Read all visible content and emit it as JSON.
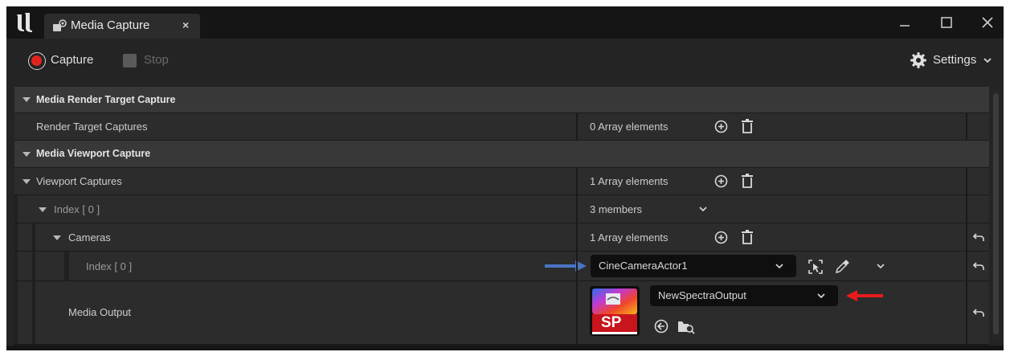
{
  "window": {
    "tab_title": "Media Capture",
    "tab_close": "×",
    "controls": [
      "minimize-icon",
      "maximize-icon",
      "close-icon"
    ]
  },
  "toolbar": {
    "capture_label": "Capture",
    "stop_label": "Stop",
    "settings_label": "Settings"
  },
  "details": {
    "categories": [
      {
        "label": "Media Render Target Capture"
      },
      {
        "label": "Media Viewport Capture"
      }
    ],
    "render_target_captures": {
      "name": "Render Target Captures",
      "value": "0 Array elements"
    },
    "viewport_captures": {
      "name": "Viewport Captures",
      "value": "1 Array elements"
    },
    "index_0": {
      "name": "Index [ 0 ]",
      "value": "3 members"
    },
    "cameras": {
      "name": "Cameras",
      "value": "1 Array elements"
    },
    "camera_index_0": {
      "name": "Index [ 0 ]",
      "value": "CineCameraActor1"
    },
    "media_output": {
      "name": "Media Output",
      "value": "NewSpectraOutput",
      "thumbnail_text": "SP"
    }
  },
  "colors": {
    "capture_red": "#e0251f",
    "annotation_blue": "#4a74c4",
    "annotation_red": "#e81b1b",
    "category_bg": "#383838",
    "row_bg": "#2c2c2c"
  }
}
